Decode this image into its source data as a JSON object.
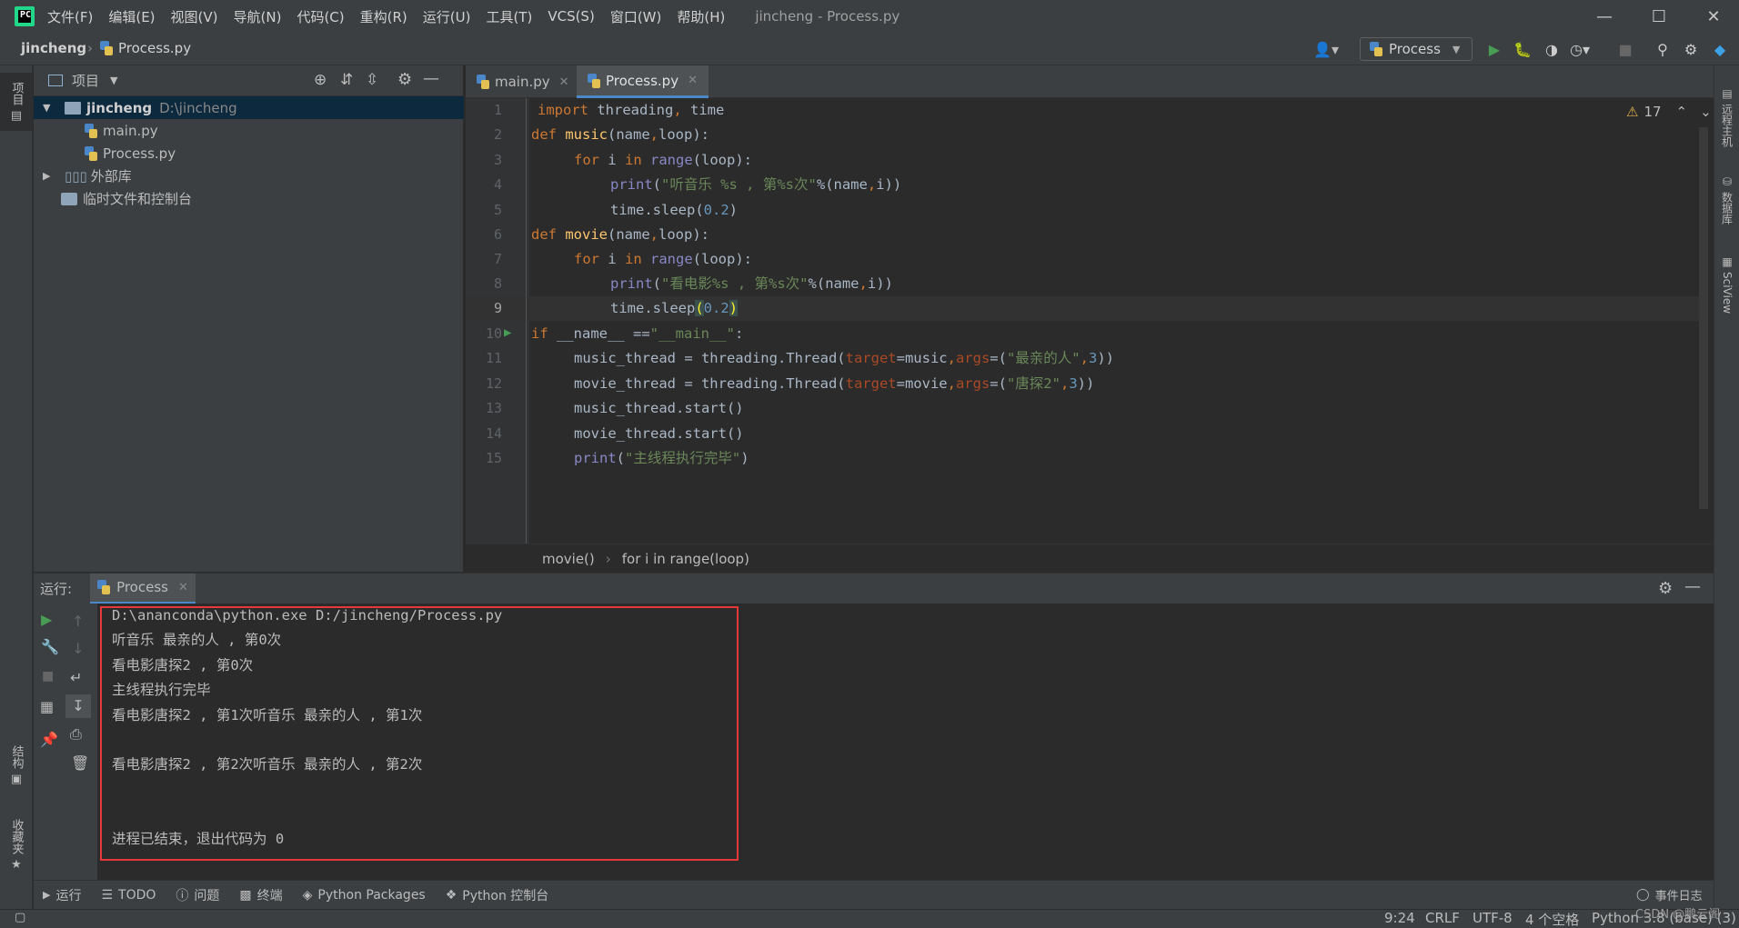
{
  "menu": [
    "文件(F)",
    "编辑(E)",
    "视图(V)",
    "导航(N)",
    "代码(C)",
    "重构(R)",
    "运行(U)",
    "工具(T)",
    "VCS(S)",
    "窗口(W)",
    "帮助(H)"
  ],
  "window_title": "jincheng - Process.py",
  "breadcrumb_nav": {
    "project": "jincheng",
    "file": "Process.py"
  },
  "run_config": "Process",
  "project_panel": {
    "title": "项目",
    "root_name": "jincheng",
    "root_path": "D:\\jincheng",
    "files": [
      "main.py",
      "Process.py"
    ],
    "external": "外部库",
    "scratches": "临时文件和控制台"
  },
  "left_tabs": {
    "project": "项目",
    "structure": "结构",
    "favorites": "收藏夹"
  },
  "right_tabs": {
    "remote": "远程主机",
    "database": "数据库",
    "sciview": "SciView"
  },
  "editor_tabs": [
    {
      "label": "main.py",
      "active": false
    },
    {
      "label": "Process.py",
      "active": true
    }
  ],
  "warnings_count": "17",
  "line_numbers": [
    "1",
    "2",
    "3",
    "4",
    "5",
    "6",
    "7",
    "8",
    "9",
    "10",
    "11",
    "12",
    "13",
    "14",
    "15"
  ],
  "code_tokens": {
    "l1": [
      "import",
      " threading",
      ",",
      " time"
    ],
    "l2": [
      "def ",
      "music",
      "(name",
      ",",
      "loop):"
    ],
    "l3": [
      "for",
      " i ",
      "in",
      " range",
      "(loop):"
    ],
    "l4": [
      "print",
      "(",
      "\"听音乐 %s , 第%s次\"",
      "%",
      "(name",
      ",",
      "i))"
    ],
    "l5": [
      "time.sleep(",
      "0.2",
      ")"
    ],
    "l6": [
      "def ",
      "movie",
      "(name",
      ",",
      "loop):"
    ],
    "l7": [
      "for",
      " i ",
      "in",
      " range",
      "(loop):"
    ],
    "l8": [
      "print",
      "(",
      "\"看电影%s , 第%s次\"",
      "%",
      "(name",
      ",",
      "i))"
    ],
    "l9": [
      "time.sleep",
      "(",
      "0.2",
      ")"
    ],
    "l10": [
      "if",
      " ",
      "__name__",
      " ==",
      "\"__main__\"",
      ":"
    ],
    "l11": [
      "music_thread = threading.Thread(",
      "target",
      "=music",
      ",",
      "args",
      "=(",
      "\"最亲的人\"",
      ",",
      "3",
      "))"
    ],
    "l12": [
      "movie_thread = threading.Thread(",
      "target",
      "=movie",
      ",",
      "args",
      "=(",
      "\"唐探2\"",
      ",",
      "3",
      "))"
    ],
    "l13": [
      "music_thread.start()"
    ],
    "l14": [
      "movie_thread.start()"
    ],
    "l15": [
      "print",
      "(",
      "\"主线程执行完毕\"",
      ")"
    ]
  },
  "code_breadcrumb": [
    "movie()",
    "for i in range(loop)"
  ],
  "run_panel": {
    "label": "运行:",
    "tab": "Process"
  },
  "console_lines": [
    "D:\\ananconda\\python.exe D:/jincheng/Process.py",
    "听音乐 最亲的人 , 第0次",
    "看电影唐探2 , 第0次",
    "主线程执行完毕",
    "看电影唐探2 , 第1次听音乐 最亲的人 , 第1次",
    "",
    "看电影唐探2 , 第2次听音乐 最亲的人 , 第2次",
    "",
    "",
    "进程已结束，退出代码为 0"
  ],
  "bottom_tabs": [
    "运行",
    "TODO",
    "问题",
    "终端",
    "Python Packages",
    "Python 控制台"
  ],
  "event_log": "事件日志",
  "status": {
    "position": "9:24",
    "line_sep": "CRLF",
    "encoding": "UTF-8",
    "indent": "4 个空格",
    "interpreter": "Python 3.8 (base) (3)"
  },
  "watermark": "CSDN @鹏云阁",
  "colors": {
    "accent_green": "#499c54",
    "selection_blue": "#0d293e",
    "red_highlight": "#e53838"
  }
}
